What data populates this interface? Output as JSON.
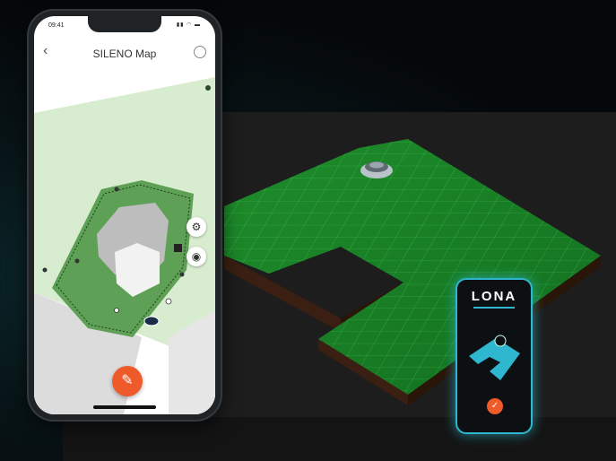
{
  "phone": {
    "status_time": "09:41",
    "status_icons": "▮▮ ◠ ▬",
    "title": "SILENO Map",
    "back_icon": "‹",
    "gear_icon": "⚙",
    "eye_icon": "◉",
    "fab_icon": "✎"
  },
  "lona_phone": {
    "logo": "LONA",
    "confirm_icon": "✓"
  },
  "colors": {
    "accent_orange": "#ef5a2a",
    "lona_cyan": "#2fb7cf",
    "lawn_green": "#1f8a2a",
    "map_green": "#cfe8c4"
  }
}
